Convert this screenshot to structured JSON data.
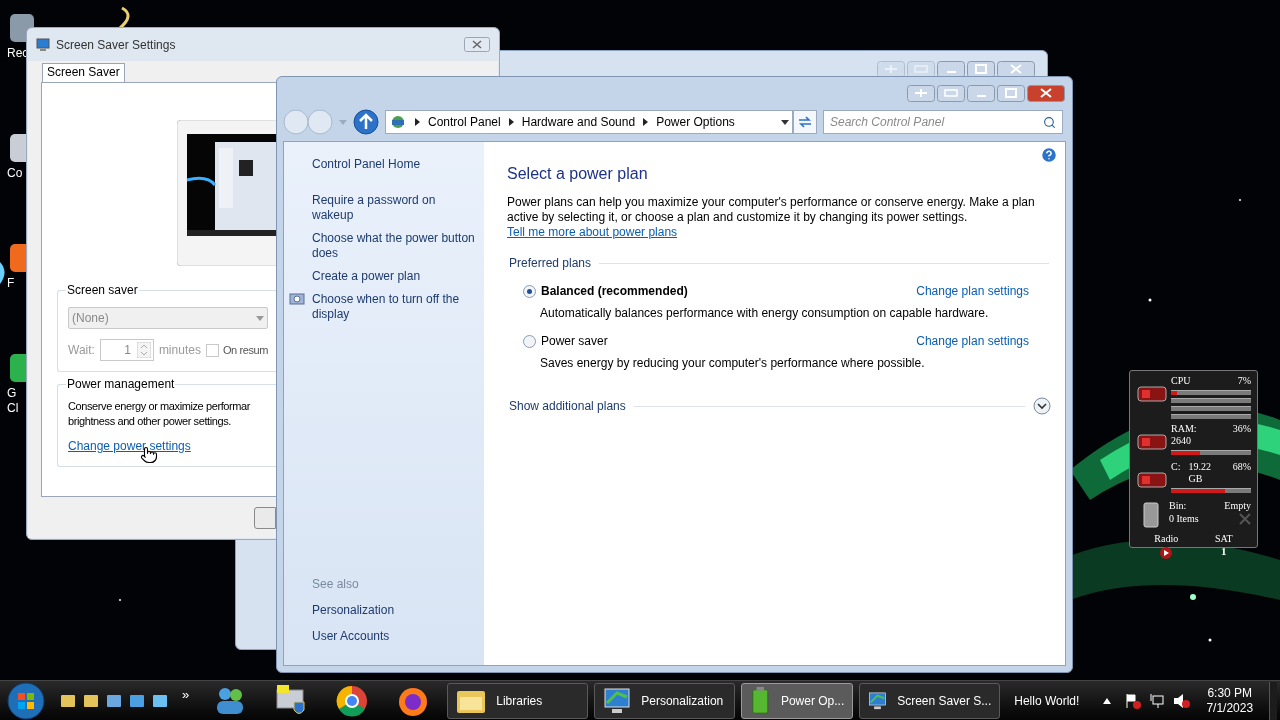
{
  "desktop_icons": [
    {
      "lines": [
        "Rec"
      ]
    },
    {
      "lines": [
        "Co"
      ]
    },
    {
      "lines": [
        "F"
      ]
    },
    {
      "lines": [
        "G",
        "Cl"
      ]
    }
  ],
  "screen_saver_window": {
    "title": "Screen Saver Settings",
    "tabs": [
      {
        "label": "Screen Saver",
        "selected": true
      }
    ],
    "screen_saver_group": {
      "legend": "Screen saver",
      "dropdown": {
        "value": "(None)",
        "disabled": true
      },
      "wait_label": "Wait:",
      "wait_value": "1",
      "minutes_label": "minutes",
      "resume_checkbox": {
        "label": "On resum",
        "checked": false
      }
    },
    "power_group": {
      "legend": "Power management",
      "lines": [
        "Conserve energy or maximize performar",
        "brightness and other power settings."
      ],
      "link": "Change power settings"
    }
  },
  "control_panel_window": {
    "breadcrumb": [
      "Control Panel",
      "Hardware and Sound",
      "Power Options"
    ],
    "search_placeholder": "Search Control Panel",
    "nav": {
      "home": "Control Panel Home",
      "links": [
        {
          "label": "Require a password on wakeup",
          "kind": "plain"
        },
        {
          "label": "Choose what the power button does",
          "kind": "plain"
        },
        {
          "label": "Create a power plan",
          "kind": "plain"
        },
        {
          "label": "Choose when to turn off the display",
          "kind": "icon"
        }
      ],
      "see_also_heading": "See also",
      "see_also": [
        "Personalization",
        "User Accounts"
      ]
    },
    "heading": "Select a power plan",
    "intro": "Power plans can help you maximize your computer's performance or conserve energy. Make a plan active by selecting it, or choose a plan and customize it by changing its power settings.",
    "intro_link": "Tell me more about power plans",
    "preferred_heading": "Preferred plans",
    "plans": [
      {
        "name": "Balanced (recommended)",
        "description": "Automatically balances performance with energy consumption on capable hardware.",
        "action": "Change plan settings",
        "selected": true
      },
      {
        "name": "Power saver",
        "description": "Saves energy by reducing your computer's performance where possible.",
        "action": "Change plan settings",
        "selected": false
      }
    ],
    "additional": {
      "label": "Show additional plans",
      "expanded": false
    }
  },
  "gadget": {
    "meters": [
      {
        "kind": "cpu",
        "label": "CPU",
        "reading": "7%",
        "level": 0.07
      },
      {
        "kind": "ram",
        "label": "RAM: 2640",
        "reading": "36%",
        "level": 0.36
      },
      {
        "kind": "disk",
        "label": "C:",
        "detail": "19.22 GB",
        "reading": "68%",
        "level": 0.68
      }
    ],
    "bin": {
      "label": "Bin:",
      "status": "Empty",
      "items": "0 Items"
    },
    "radio": "Radio",
    "day": "SAT",
    "date": "1"
  },
  "taskbar": {
    "overflow": "»",
    "tasks": [
      {
        "label": "Libraries",
        "kind": "folder",
        "selected": false
      },
      {
        "label": "Personalization",
        "kind": "monitor",
        "selected": false
      },
      {
        "label": "Power Op...",
        "kind": "battery",
        "selected": true
      },
      {
        "label": "Screen Saver S...",
        "kind": "monitor",
        "selected": false
      }
    ],
    "notification": "Hello World!",
    "time": "6:30 PM",
    "date": "7/1/2023"
  }
}
